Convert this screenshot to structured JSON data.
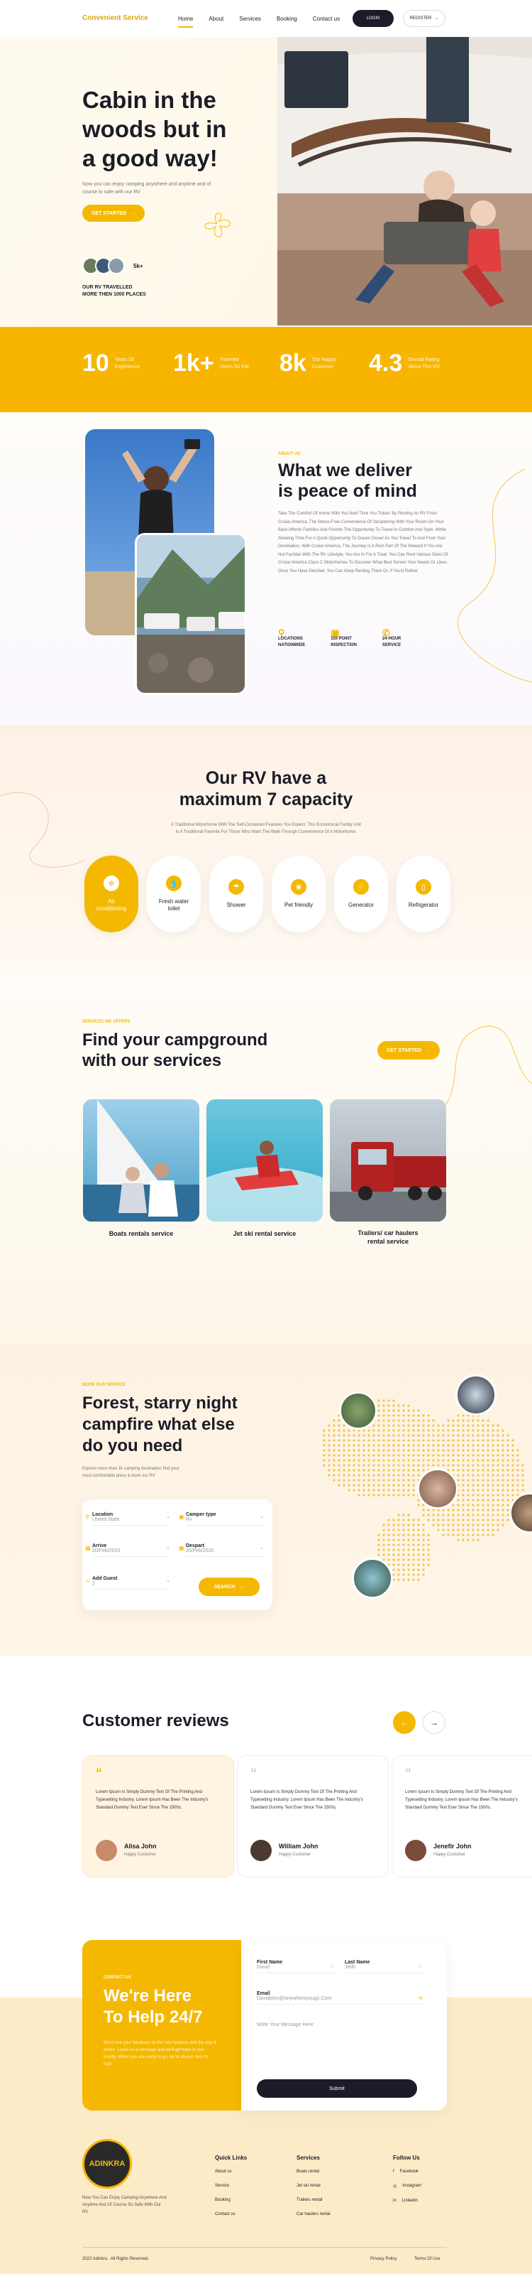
{
  "header": {
    "logo": "Convenient Service",
    "nav": [
      "Home",
      "About",
      "Services",
      "Booking",
      "Contact us"
    ],
    "login": "LOGIN",
    "register": "REGISTER"
  },
  "hero": {
    "title_line1": "Cabin in the",
    "title_line2": "woods but in",
    "title_line3": "a good way!",
    "subtitle": "Now you can enjoy camping anywhere and anytime and of course to safe with our RV",
    "cta": "GET STARTED",
    "avatar_count": "5k+",
    "traveled_line1": "OUR RV TRAVELLED",
    "traveled_line2": "MORE THEN 1000 PLACES"
  },
  "stats": [
    {
      "num": "10",
      "label1": "Years Of",
      "label2": "Experience"
    },
    {
      "num": "1k+",
      "label1": "Traveled",
      "label2": "Users So Fat"
    },
    {
      "num": "8k",
      "label1": "Our Happy",
      "label2": "Customer"
    },
    {
      "num": "4.3",
      "label1": "Overall Rating",
      "label2": "About This RV"
    }
  ],
  "about": {
    "eyebrow": "ABOUT US",
    "title_line1": "What we deliver",
    "title_line2": "is peace of mind",
    "body": "Take The Comfort Of Home With You Next Time You Travel. By Renting An RV From Cruise America, The Stress-Free Convenience Of Vacationing With Your Room-On-Your Back Affords Families And Friends The Opportunity To Travel In Comfort And Style. While Allowing Time For A Quick Opportunity To Dream Closer As You Travel To And From Your Destination. With Cruise America, The Journey Is A Rich Part Of The Reward If You Are Not Familiar With The RV Lifestyle, You Are In For A Treat. You Can Rent Various Sizes Of Cruise America Class C Motorhomes To Discover What Best Serves Your Needs Or Likes. Once You Have Decided, You Can Keep Renting Them Or, If You'd Rather",
    "features": [
      {
        "l1": "LOCATIONS",
        "l2": "NATIONWIDE"
      },
      {
        "l1": "110 POINT",
        "l2": "INSPECTION"
      },
      {
        "l1": "24-HOUR",
        "l2": "SERVICE"
      }
    ]
  },
  "capacity": {
    "title_line1": "Our RV have a",
    "title_line2": "maximum 7 capacity",
    "subtitle_line1": "A Traditional Motorhome With The Self-Contained Features You Expect. This Economical Family Unit",
    "subtitle_line2": "Is A Traditional Favorite For Those Who Want The Walk-Through Convenience Of A Motorhome.",
    "items": [
      {
        "l1": "Air",
        "l2": "conditioning",
        "icon": "air-icon"
      },
      {
        "l1": "Fresh water",
        "l2": "toilet",
        "icon": "water-drop-icon"
      },
      {
        "l1": "Shower",
        "l2": "",
        "icon": "shower-icon"
      },
      {
        "l1": "Pet friendly",
        "l2": "",
        "icon": "paw-icon"
      },
      {
        "l1": "Generator",
        "l2": "",
        "icon": "generator-icon"
      },
      {
        "l1": "Refrigerator",
        "l2": "",
        "icon": "fridge-icon"
      }
    ]
  },
  "services": {
    "eyebrow": "SERVICES WE OFFERS",
    "title_line1": "Find your campground",
    "title_line2": "with our services",
    "cta": "GET STARTED",
    "cards": [
      {
        "l1": "Boats rentals service",
        "l2": ""
      },
      {
        "l1": "Jet ski rental service",
        "l2": ""
      },
      {
        "l1": "Trailers/ car haulers",
        "l2": "rental service"
      }
    ]
  },
  "booking": {
    "eyebrow": "BOOK OUR SERVICE",
    "title_line1": "Forest, starry night",
    "title_line2": "campfire what else",
    "title_line3": "do you need",
    "subtitle_line1": "Explore more than 1k camping destination find your",
    "subtitle_line2": "most comfortable place & book our RV",
    "fields": [
      {
        "label": "Location",
        "value": "United State"
      },
      {
        "label": "Camper type",
        "value": "Rv"
      },
      {
        "label": "Arrive",
        "value": "20/Feb/2020"
      },
      {
        "label": "Despart",
        "value": "20/Feb/2020"
      },
      {
        "label": "Add Guest",
        "value": "2"
      }
    ],
    "search": "SEARCH"
  },
  "reviews": {
    "title": "Customer reviews",
    "items": [
      {
        "text": "Lorem Ipsum Is Simply Dummy Text Of The Printing And Typesetting Industry. Lorem Ipsum Has Been The Industry's Standard Dummy Text Ever Since The 1500s,",
        "name": "Alisa John",
        "role": "Happy Customer"
      },
      {
        "text": "Lorem Ipsum Is Simply Dummy Text Of The Printing And Typesetting Industry. Lorem Ipsum Has Been The Industry's Standard Dummy Text Ever Since The 1500s,",
        "name": "William John",
        "role": "Happy Customer"
      },
      {
        "text": "Lorem Ipsum Is Simply Dummy Text Of The Printing And Typesetting Industry. Lorem Ipsum Has Been The Industry's Standard Dummy Text Ever Since The 1500s,",
        "name": "Jenefir John",
        "role": "Happy Customer"
      }
    ]
  },
  "contact": {
    "eyebrow": "CONTACT US",
    "title_line1": "We're Here",
    "title_line2": "To Help 24/7",
    "body": "We'd love your feedback on the new features and the way it works. Leave us a message and we'll get back to you shortly. When you are ready to go, we're always here to help",
    "first_name_label": "First Name",
    "first_name_value": "David",
    "last_name_label": "Last Name",
    "last_name_value": "Jedh",
    "email_label": "Email",
    "email_value": "Davidjohn@Anywhereyougo.Com",
    "message_placeholder": "Write Your Message Here",
    "submit": "Submit"
  },
  "footer": {
    "brand": "ADINKRA",
    "tagline": "Now You Can Enjoy Camping Anywhere And Anytime And Of Course So Safe With Our RV",
    "cols": [
      {
        "title": "Quick Links",
        "items": [
          "About us",
          "Service",
          "Booking",
          "Contact us"
        ]
      },
      {
        "title": "Services",
        "items": [
          "Boats rental",
          "Jet ski rental",
          "Trailers rental",
          "Car haulers rental"
        ]
      },
      {
        "title": "Follow Us",
        "items": [
          "Facebook",
          "Instagram",
          "Linkedin"
        ]
      }
    ],
    "copyright": "2022 Adinkra . All Rights Reserved.",
    "privacy": "Privacy Policy",
    "terms": "Terms Of Use"
  },
  "colors": {
    "accent": "#f5b800",
    "dark": "#1c1c28"
  }
}
